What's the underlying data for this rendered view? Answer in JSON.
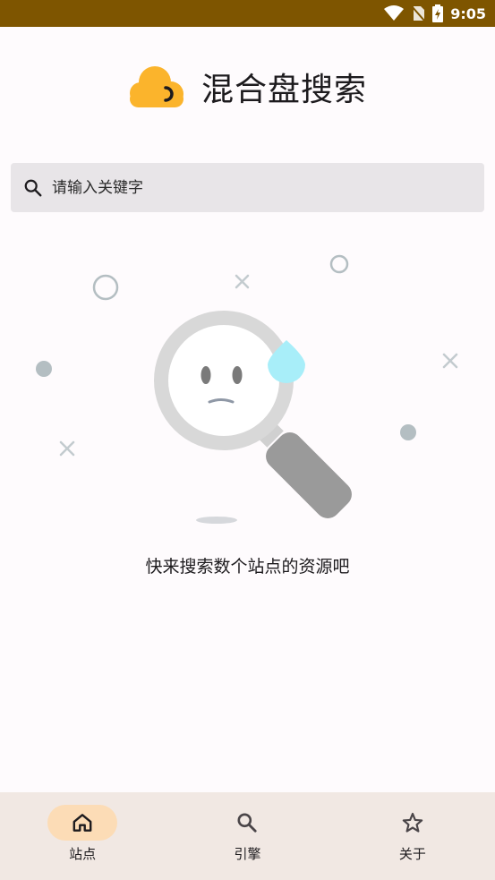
{
  "status_bar": {
    "time": "9:05"
  },
  "header": {
    "title": "混合盘搜索",
    "logo_color": "#fbb42c"
  },
  "search": {
    "placeholder": "请输入关键字"
  },
  "empty_state": {
    "message": "快来搜索数个站点的资源吧"
  },
  "bottom_nav": {
    "items": [
      {
        "label": "站点",
        "icon": "home-icon",
        "active": true
      },
      {
        "label": "引擎",
        "icon": "search-icon",
        "active": false
      },
      {
        "label": "关于",
        "icon": "star-icon",
        "active": false
      }
    ]
  },
  "colors": {
    "status_bar": "#7e5500",
    "accent": "#fbb42c",
    "nav_active_pill": "#fcdcb6",
    "nav_background": "#f1e8e3",
    "search_background": "#e8e5e8"
  }
}
